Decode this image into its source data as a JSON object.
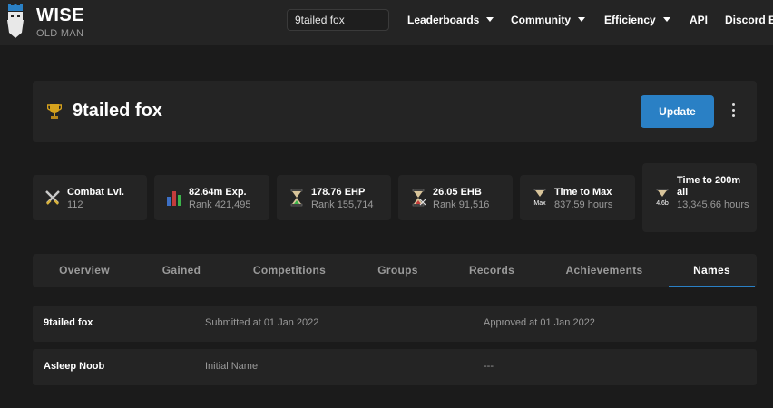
{
  "nav": {
    "brand_name": "WISE",
    "brand_sub": "OLD MAN",
    "search_value": "9tailed fox",
    "items": [
      {
        "label": "Leaderboards"
      },
      {
        "label": "Community"
      },
      {
        "label": "Efficiency"
      },
      {
        "label": "API"
      },
      {
        "label": "Discord Bo"
      }
    ]
  },
  "header": {
    "player_name": "9tailed fox",
    "update_label": "Update"
  },
  "stats": [
    {
      "icon": "combat-swords-icon",
      "title": "Combat Lvl.",
      "sub": "112"
    },
    {
      "icon": "bar-chart-icon",
      "title": "82.64m Exp.",
      "sub": "Rank 421,495"
    },
    {
      "icon": "hourglass-green-icon",
      "title": "178.76 EHP",
      "sub": "Rank 155,714"
    },
    {
      "icon": "hourglass-red-icon",
      "title": "26.05 EHB",
      "sub": "Rank 91,516"
    },
    {
      "icon": "hourglass-max-icon",
      "icon_text": "Max",
      "title": "Time to Max",
      "sub": "837.59 hours"
    },
    {
      "icon": "hourglass-4.6b-icon",
      "icon_text": "4.6b",
      "title": "Time to 200m all",
      "sub": "13,345.66 hours"
    }
  ],
  "tabs": [
    {
      "label": "Overview"
    },
    {
      "label": "Gained"
    },
    {
      "label": "Competitions"
    },
    {
      "label": "Groups"
    },
    {
      "label": "Records"
    },
    {
      "label": "Achievements"
    },
    {
      "label": "Names",
      "active": true
    }
  ],
  "names": [
    {
      "name": "9tailed fox",
      "submitted": "Submitted at 01 Jan 2022",
      "approved": "Approved at 01 Jan 2022"
    },
    {
      "name": "Asleep Noob",
      "submitted": "Initial Name",
      "approved": "---"
    }
  ],
  "colors": {
    "background": "#1b1b1b",
    "card": "#242424",
    "accent": "#2a80c5",
    "muted_text": "#9a9a9a"
  }
}
